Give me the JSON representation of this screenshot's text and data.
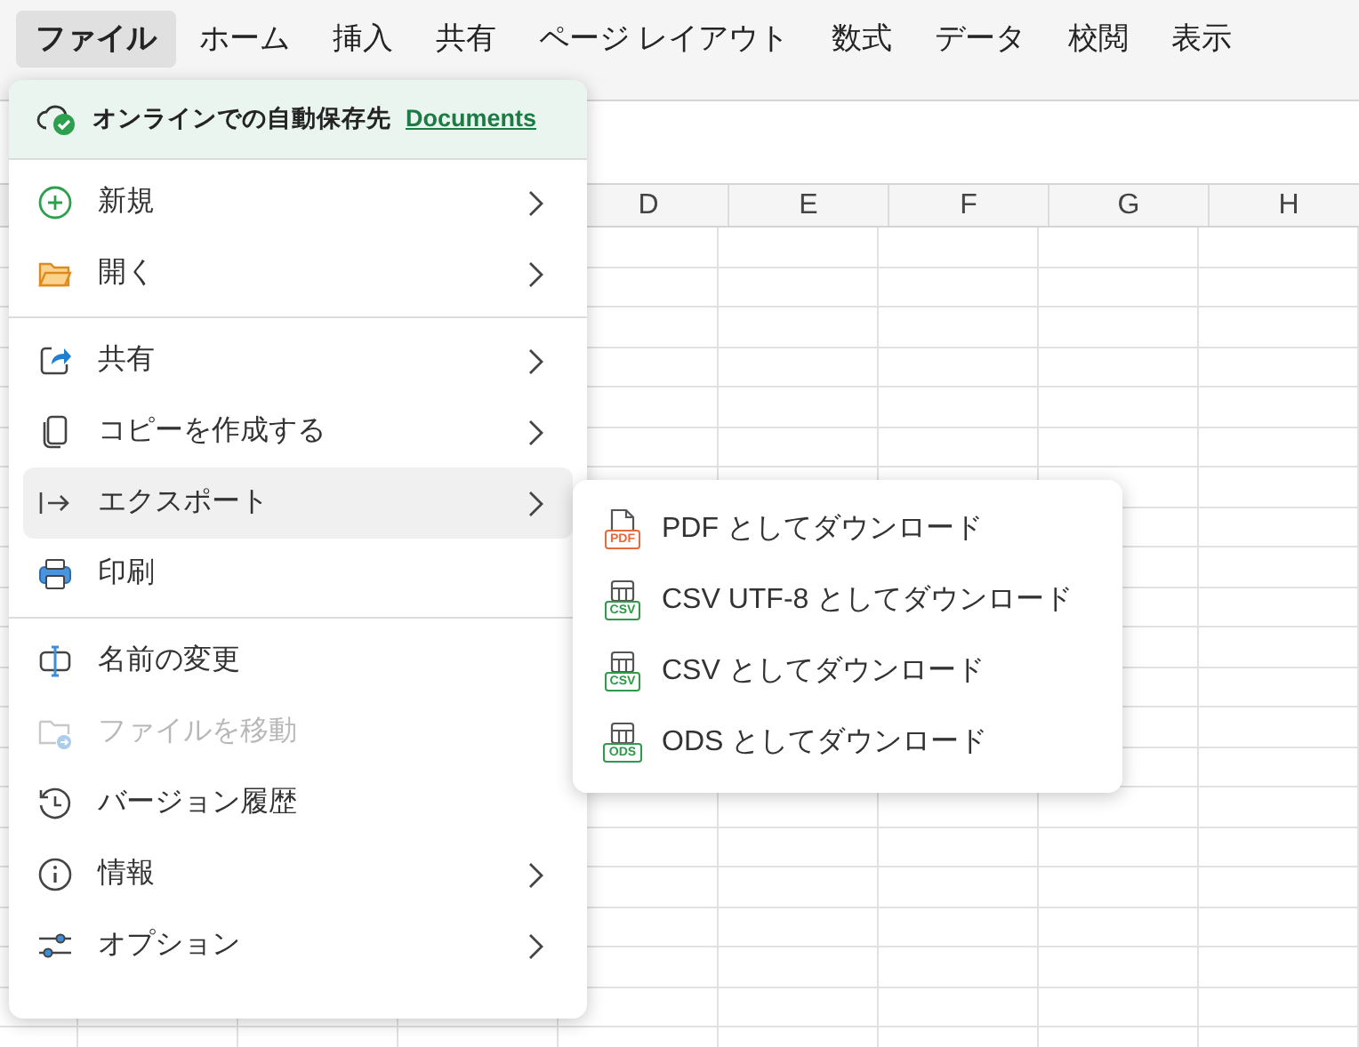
{
  "ribbon_tabs": [
    {
      "label": "ファイル",
      "selected": true
    },
    {
      "label": "ホーム",
      "selected": false
    },
    {
      "label": "挿入",
      "selected": false
    },
    {
      "label": "共有",
      "selected": false
    },
    {
      "label": "ページ レイアウト",
      "selected": false
    },
    {
      "label": "数式",
      "selected": false
    },
    {
      "label": "データ",
      "selected": false
    },
    {
      "label": "校閲",
      "selected": false
    },
    {
      "label": "表示",
      "selected": false
    }
  ],
  "column_headers": [
    "D",
    "E",
    "F",
    "G",
    "H"
  ],
  "file_menu": {
    "autosave": {
      "text": "オンラインでの自動保存先",
      "link": "Documents"
    },
    "groups": [
      [
        {
          "kind": "new",
          "label": "新規",
          "submenu": true,
          "disabled": false,
          "selected": false
        },
        {
          "kind": "open",
          "label": "開く",
          "submenu": true,
          "disabled": false,
          "selected": false
        }
      ],
      [
        {
          "kind": "share",
          "label": "共有",
          "submenu": true,
          "disabled": false,
          "selected": false
        },
        {
          "kind": "copy",
          "label": "コピーを作成する",
          "submenu": true,
          "disabled": false,
          "selected": false
        },
        {
          "kind": "export",
          "label": "エクスポート",
          "submenu": true,
          "disabled": false,
          "selected": true
        },
        {
          "kind": "print",
          "label": "印刷",
          "submenu": false,
          "disabled": false,
          "selected": false
        }
      ],
      [
        {
          "kind": "rename",
          "label": "名前の変更",
          "submenu": false,
          "disabled": false,
          "selected": false
        },
        {
          "kind": "move",
          "label": "ファイルを移動",
          "submenu": false,
          "disabled": true,
          "selected": false
        },
        {
          "kind": "history",
          "label": "バージョン履歴",
          "submenu": false,
          "disabled": false,
          "selected": false
        },
        {
          "kind": "info",
          "label": "情報",
          "submenu": true,
          "disabled": false,
          "selected": false
        },
        {
          "kind": "options",
          "label": "オプション",
          "submenu": true,
          "disabled": false,
          "selected": false
        }
      ]
    ]
  },
  "export_submenu": [
    {
      "kind": "pdf",
      "icon_label": "PDF",
      "label": "PDF としてダウンロード"
    },
    {
      "kind": "table",
      "icon_label": "CSV",
      "label": "CSV UTF-8 としてダウンロード"
    },
    {
      "kind": "table",
      "icon_label": "CSV",
      "label": "CSV としてダウンロード"
    },
    {
      "kind": "table",
      "icon_label": "ODS",
      "label": "ODS としてダウンロード"
    }
  ]
}
